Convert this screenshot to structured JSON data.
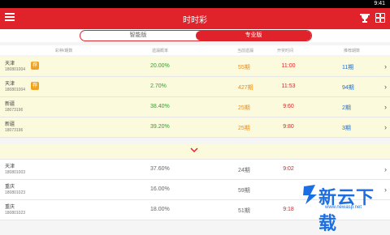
{
  "status_bar": {
    "time": "9:41"
  },
  "app_bar": {
    "title": "时时彩",
    "icons": [
      "menu-icon",
      "trophy-icon",
      "grid-icon"
    ]
  },
  "segmented": {
    "left_label": "智能版",
    "right_label": "专业版",
    "selected": "专业版"
  },
  "column_headers": [
    "彩种/期数",
    "遗漏概率",
    "当前遗漏",
    "开奖时间",
    "推荐期数"
  ],
  "rows": [
    {
      "name": "天津",
      "code": "180801004",
      "badge": "荐",
      "percent": "20.00%",
      "periods": "55期",
      "time": "11:00",
      "next": "11期"
    },
    {
      "name": "天津",
      "code": "180801004",
      "badge": "荐",
      "percent": "2.70%",
      "periods": "427期",
      "time": "11:53",
      "next": "94期"
    },
    {
      "name": "新疆",
      "code": "18073196",
      "percent": "38.40%",
      "periods": "25期",
      "time": "9:60",
      "next": "2期"
    },
    {
      "name": "新疆",
      "code": "18073196",
      "percent": "39.20%",
      "periods": "25期",
      "time": "9:80",
      "next": "3期"
    },
    {
      "name": "天津",
      "code": "180801003",
      "percent": "37.60%",
      "periods": "24期",
      "time": "9:02",
      "next": ""
    },
    {
      "name": "重庆",
      "code": "180801023",
      "percent": "16.00%",
      "periods": "59期",
      "time": "",
      "next": ""
    },
    {
      "name": "重庆",
      "code": "180801023",
      "percent": "18.00%",
      "periods": "51期",
      "time": "9:18",
      "next": ""
    }
  ],
  "watermark": {
    "text": "新云下载",
    "url": "www.newasp.net"
  },
  "colors": {
    "primary": "#e0232b",
    "highlight_bg": "#fcfadd",
    "green": "#2da12d",
    "orange": "#f28a0c",
    "blue": "#1c6fd1"
  }
}
